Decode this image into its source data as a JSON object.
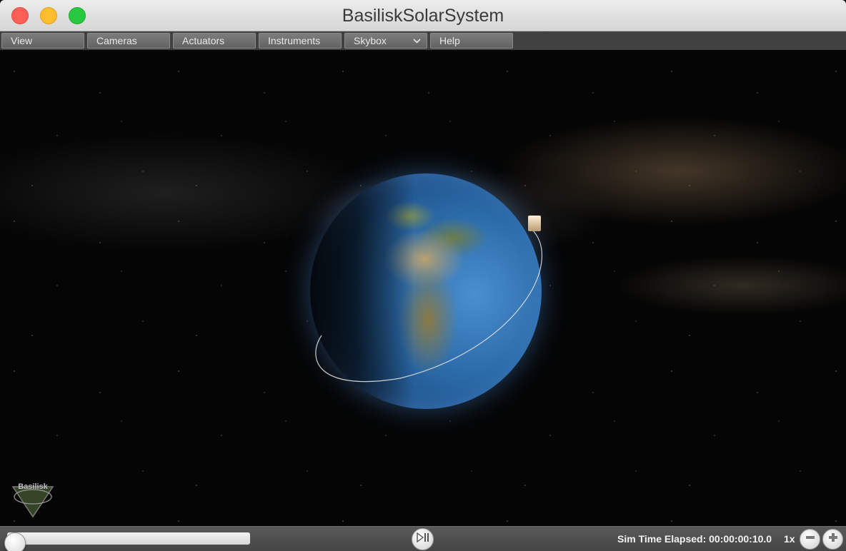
{
  "window": {
    "title": "BasiliskSolarSystem"
  },
  "menubar": {
    "items": [
      {
        "label": "View"
      },
      {
        "label": "Cameras"
      },
      {
        "label": "Actuators"
      },
      {
        "label": "Instruments"
      },
      {
        "label": "Skybox",
        "has_dropdown": true
      },
      {
        "label": "Help"
      }
    ]
  },
  "logo": {
    "text": "Basilisk"
  },
  "bottombar": {
    "sim_time_label": "Sim Time Elapsed: 00:00:00:10.0",
    "speed": "1x",
    "timeline_progress": 0.0
  },
  "icons": {
    "play_pause": "play-pause-icon",
    "decrease": "minus-icon",
    "increase": "plus-icon",
    "skybox_dropdown": "chevron-down-icon"
  },
  "colors": {
    "close": "#fd5f57",
    "minimize": "#febc2e",
    "maximize": "#28c840",
    "menubar_bg": "#464646",
    "button_bg": "#6e6e6e"
  }
}
